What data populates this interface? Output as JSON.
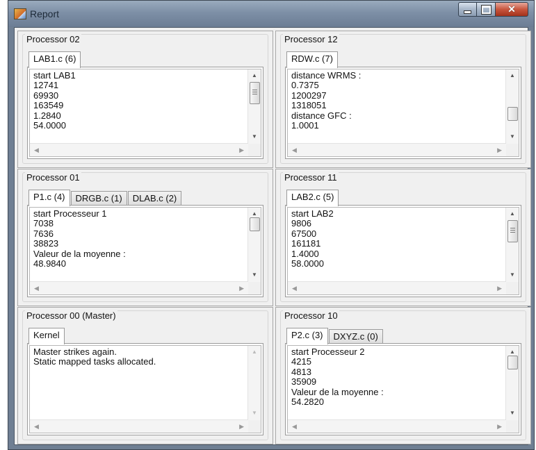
{
  "window": {
    "title": "Report",
    "controls": {
      "minimize": "minimize",
      "maximize": "maximize",
      "close": "✕"
    }
  },
  "panels": [
    {
      "title": "Processor 02",
      "tabs": [
        "LAB1.c (6)"
      ],
      "active_tab": 0,
      "lines": [
        "start LAB1",
        "12741",
        "69930",
        "163549",
        "1.2840",
        "54.0000"
      ],
      "scroll_thumb": "middle"
    },
    {
      "title": "Processor 12",
      "tabs": [
        "RDW.c (7)"
      ],
      "active_tab": 0,
      "lines": [
        "distance WRMS :",
        "0.7375",
        "1200297",
        "1318051",
        "distance GFC :",
        "1.0001"
      ],
      "scroll_thumb": "bottom"
    },
    {
      "title": "Processor 01",
      "tabs": [
        "P1.c (4)",
        "DRGB.c (1)",
        "DLAB.c (2)"
      ],
      "active_tab": 0,
      "lines": [
        "start Processeur 1",
        "7038",
        "7636",
        "38823",
        "Valeur de la moyenne :",
        "48.9840"
      ],
      "scroll_thumb": "top"
    },
    {
      "title": "Processor 11",
      "tabs": [
        "LAB2.c (5)"
      ],
      "active_tab": 0,
      "lines": [
        "start LAB2",
        "9806",
        "67500",
        "161181",
        "1.4000",
        "58.0000"
      ],
      "scroll_thumb": "middle"
    },
    {
      "title": "Processor 00 (Master)",
      "tabs": [
        "Kernel"
      ],
      "active_tab": 0,
      "lines": [
        "Master strikes again.",
        "Static mapped tasks allocated."
      ],
      "scroll_thumb": "none"
    },
    {
      "title": "Processor 10",
      "tabs": [
        "P2.c (3)",
        "DXYZ.c (0)"
      ],
      "active_tab": 0,
      "lines": [
        "start Processeur 2",
        "4215",
        "4813",
        "35909",
        "Valeur de la moyenne :",
        "54.2820"
      ],
      "scroll_thumb": "top"
    }
  ]
}
